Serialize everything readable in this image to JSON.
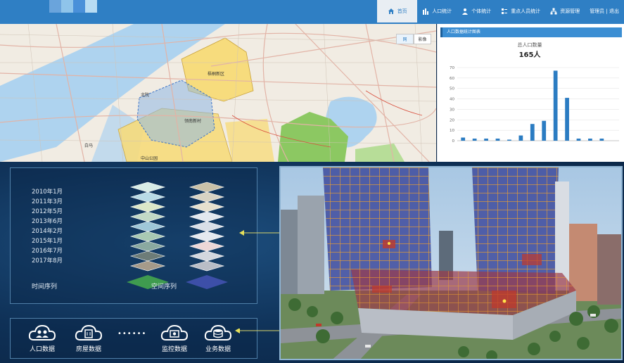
{
  "nav": {
    "items": [
      {
        "label": "首页",
        "icon": "home-icon",
        "active": true
      },
      {
        "label": "人口统计",
        "icon": "population-icon",
        "active": false
      },
      {
        "label": "个体统计",
        "icon": "person-icon",
        "active": false
      },
      {
        "label": "重点人员统计",
        "icon": "key-people-icon",
        "active": false
      },
      {
        "label": "资源管理",
        "icon": "org-chart-icon",
        "active": false
      },
      {
        "label": "管理员 | 退出",
        "icon": "",
        "active": false
      }
    ]
  },
  "map": {
    "toggle": {
      "left": "网",
      "right": "影像"
    },
    "labels": [
      "梧桐新区",
      "领南新村",
      "北院",
      "白马",
      "中山公园"
    ]
  },
  "panel": {
    "header": "人口数据统计图表",
    "title": "总人口数量",
    "total": "165人"
  },
  "chart_data": {
    "type": "bar",
    "title": "总人口数量",
    "categories": [
      "",
      "",
      "",
      "",
      "",
      "",
      "",
      "",
      "",
      "",
      "",
      "",
      "",
      ""
    ],
    "values": [
      3,
      2,
      2,
      2,
      1,
      5,
      16,
      19,
      67,
      41,
      2,
      2,
      2,
      0
    ],
    "ylim": [
      0,
      70
    ],
    "yticks": [
      0,
      10,
      20,
      30,
      40,
      50,
      60,
      70
    ],
    "color": "#2b7cc2"
  },
  "timeline": {
    "dates": [
      "2010年1月",
      "2011年3月",
      "2012年5月",
      "2013年6月",
      "2014年2月",
      "2015年1月",
      "2016年7月",
      "2017年8月"
    ],
    "time_caption": "时间序列",
    "space_caption": "空间序列"
  },
  "sources": [
    {
      "label": "人口数据",
      "icon": "people-cloud-icon"
    },
    {
      "label": "房屋数据",
      "icon": "building-cloud-icon"
    },
    {
      "label": "监控数据",
      "icon": "camera-cloud-icon"
    },
    {
      "label": "业务数据",
      "icon": "database-cloud-icon"
    }
  ],
  "sources_ellipsis": "••••••",
  "colors": {
    "nav": "#2f7fc4",
    "accent": "#3b8ed3",
    "bar": "#2b7cc2",
    "background": "#0f3157"
  }
}
